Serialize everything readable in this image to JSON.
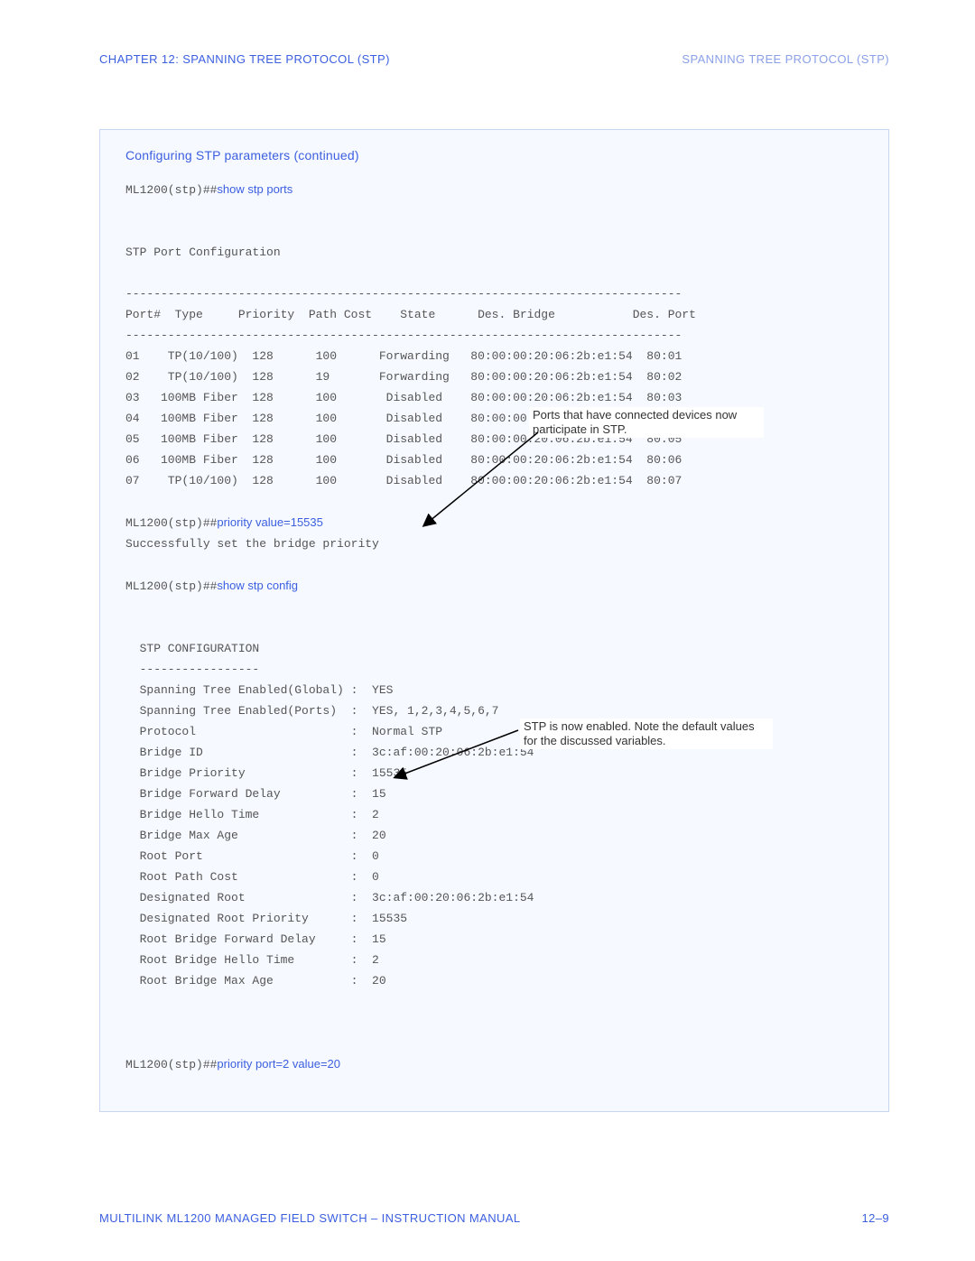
{
  "header": {
    "left": "CHAPTER 12:  SPANNING TREE PROTOCOL (STP)",
    "right": "SPANNING TREE PROTOCOL (STP)"
  },
  "box_title": "Configuring STP parameters (continued)",
  "prompt": "ML1200(stp)##",
  "cmds": {
    "show_ports": "show stp ports",
    "priority_value": "priority value=15535",
    "show_config": "show stp config",
    "priority_port": "priority port=2 value=20"
  },
  "ports_table": {
    "heading": "STP Port Configuration",
    "rule": "-------------------------------------------------------------------------------",
    "header": "Port#  Type     Priority  Path Cost    State      Des. Bridge           Des. Port",
    "rows": [
      "01    TP(10/100)  128      100      Forwarding   80:00:00:20:06:2b:e1:54  80:01",
      "02    TP(10/100)  128      19       Forwarding   80:00:00:20:06:2b:e1:54  80:02",
      "03   100MB Fiber  128      100       Disabled    80:00:00:20:06:2b:e1:54  80:03",
      "04   100MB Fiber  128      100       Disabled    80:00:00:20:06:2b:e1:54  80:04",
      "05   100MB Fiber  128      100       Disabled    80:00:00:20:06:2b:e1:54  80:05",
      "06   100MB Fiber  128      100       Disabled    80:00:00:20:06:2b:e1:54  80:06",
      "07    TP(10/100)  128      100       Disabled    80:00:00:20:06:2b:e1:54  80:07"
    ]
  },
  "priority_response": "Successfully set the bridge priority",
  "config_block": {
    "title": "  STP CONFIGURATION",
    "rule": "  -----------------",
    "lines": [
      "  Spanning Tree Enabled(Global) :  YES",
      "  Spanning Tree Enabled(Ports)  :  YES, 1,2,3,4,5,6,7",
      "  Protocol                      :  Normal STP",
      "  Bridge ID                     :  3c:af:00:20:06:2b:e1:54",
      "  Bridge Priority               :  15535",
      "  Bridge Forward Delay          :  15",
      "  Bridge Hello Time             :  2",
      "  Bridge Max Age                :  20",
      "  Root Port                     :  0",
      "  Root Path Cost                :  0",
      "  Designated Root               :  3c:af:00:20:06:2b:e1:54",
      "  Designated Root Priority      :  15535",
      "  Root Bridge Forward Delay     :  15",
      "  Root Bridge Hello Time        :  2",
      "  Root Bridge Max Age           :  20"
    ]
  },
  "annotations": {
    "ports": "Ports that have connected devices now participate in STP.",
    "enabled": "STP is now enabled. Note the default values for the discussed variables."
  },
  "footer": {
    "left": "MULTILINK ML1200 MANAGED FIELD SWITCH – INSTRUCTION MANUAL",
    "right": "12–9"
  }
}
